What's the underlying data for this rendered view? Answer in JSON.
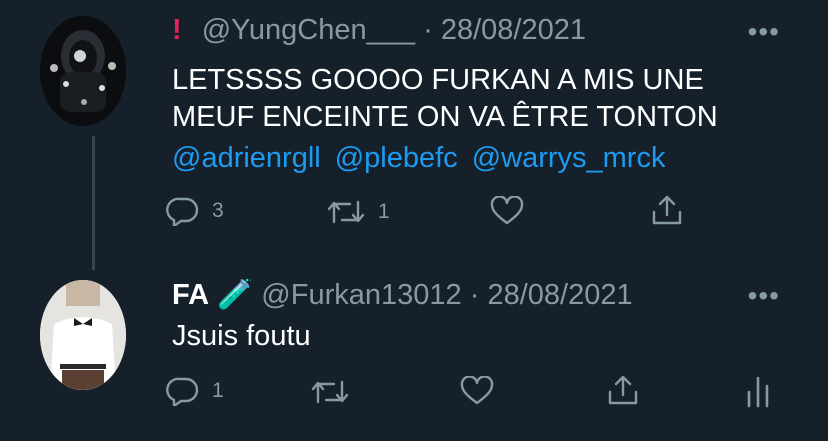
{
  "tweets": [
    {
      "warning_icon": "!",
      "handle": "@YungChen___",
      "date": "28/08/2021",
      "text_lines": [
        "LETSSSS GOOOO FURKAN A MIS UNE",
        "MEUF ENCEINTE ON VA ÊTRE TONTON"
      ],
      "mentions": [
        "@adrienrgll",
        "@plebefc",
        "@warrys_mrck"
      ],
      "more_label": "•••",
      "actions": {
        "reply_count": "3",
        "retweet_count": "1"
      }
    },
    {
      "display_name": "FA",
      "name_emoji": "🧪",
      "handle": "@Furkan13012",
      "date": "28/08/2021",
      "text": "Jsuis foutu",
      "more_label": "•••",
      "actions": {
        "reply_count": "1"
      }
    }
  ],
  "separator": "·",
  "colors": {
    "background": "#15202b",
    "secondary": "#8899a6",
    "link": "#1d9bf0",
    "text": "#ffffff"
  }
}
